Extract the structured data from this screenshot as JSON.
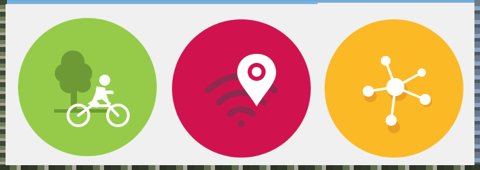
{
  "tiles": [
    {
      "id": "cycling",
      "icon": "cyclist-tree-icon",
      "color": "#95cb48"
    },
    {
      "id": "location",
      "icon": "wifi-location-pin-icon",
      "color": "#d0134f"
    },
    {
      "id": "network",
      "icon": "network-nodes-icon",
      "color": "#fbb925"
    }
  ],
  "colors": {
    "panel_background": "#f0f0f0",
    "icon_foreground": "#ffffff"
  }
}
